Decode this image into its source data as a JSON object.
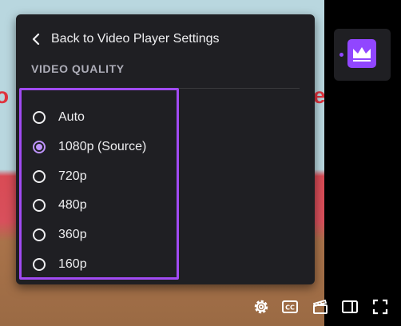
{
  "menu": {
    "back_label": "Back to Video Player Settings",
    "section_title": "VIDEO QUALITY",
    "options": [
      {
        "label": "Auto",
        "selected": false
      },
      {
        "label": "1080p (Source)",
        "selected": true
      },
      {
        "label": "720p",
        "selected": false
      },
      {
        "label": "480p",
        "selected": false
      },
      {
        "label": "360p",
        "selected": false
      },
      {
        "label": "160p",
        "selected": false
      }
    ],
    "highlight_color": "#a14bf3",
    "selected_color": "#bf94ff"
  },
  "badge": {
    "icon": "crown-icon",
    "accent": "#9146ff"
  },
  "controls": {
    "icons": [
      "settings-gear-icon",
      "closed-captions-icon",
      "clip-icon",
      "theatre-mode-icon",
      "fullscreen-icon"
    ]
  }
}
